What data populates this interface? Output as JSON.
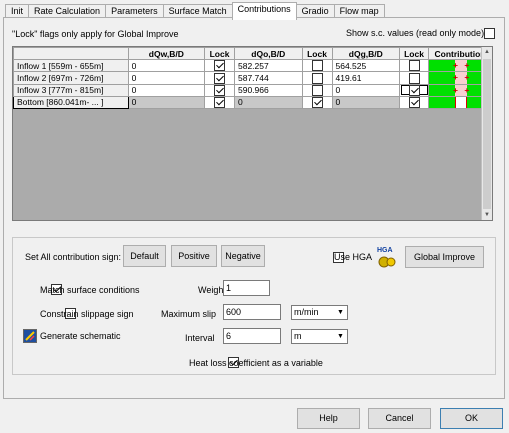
{
  "tabs": [
    "Init",
    "Rate Calculation",
    "Parameters",
    "Surface Match",
    "Contributions",
    "Gradio",
    "Flow map"
  ],
  "active_tab": "Contributions",
  "lock_note": "\"Lock\" flags only apply for Global Improve",
  "show_sc": {
    "label": "Show s.c. values (read only mode)",
    "checked": false
  },
  "grid": {
    "columns": [
      "",
      "dQw,B/D",
      "Lock",
      "dQo,B/D",
      "Lock",
      "dQg,B/D",
      "Lock",
      "Contribution"
    ],
    "rows": [
      {
        "name": "Inflow 1  [559m - 655m]",
        "dqw": "0",
        "lock_w": true,
        "dqo": "582.257",
        "lock_o": false,
        "dqg": "564.525",
        "lock_g": false,
        "contrib": "+ +"
      },
      {
        "name": "Inflow 2  [697m - 726m]",
        "dqw": "0",
        "lock_w": true,
        "dqo": "587.744",
        "lock_o": false,
        "dqg": "419.61",
        "lock_g": false,
        "contrib": "+ +"
      },
      {
        "name": "Inflow 3  [777m - 815m]",
        "dqw": "0",
        "lock_w": true,
        "dqo": "590.966",
        "lock_o": false,
        "dqg": "0",
        "lock_g": true,
        "contrib": "+ +"
      },
      {
        "name": "Bottom   [860.041m- ... ]",
        "dqw": "0",
        "lock_w": true,
        "dqo": "0",
        "lock_o": true,
        "dqg": "0",
        "lock_g": true,
        "contrib": ""
      }
    ]
  },
  "contribution_sign": {
    "label": "Set All contribution sign:",
    "default_label": "Default",
    "positive_label": "Positive",
    "negative_label": "Negative"
  },
  "use_hga": {
    "label": "Use HGA",
    "checked": false,
    "icon_text": "HGA"
  },
  "global_improve_label": "Global Improve",
  "match_surface": {
    "label": "Match surface conditions",
    "checked": true
  },
  "constrain_slippage": {
    "label": "Constrain slippage sign",
    "checked": false
  },
  "generate_schematic_label": "Generate schematic",
  "weight": {
    "label": "Weight",
    "value": "1"
  },
  "max_slip": {
    "label": "Maximum slip",
    "value": "600",
    "unit": "m/min"
  },
  "interval": {
    "label": "Interval",
    "value": "6",
    "unit": "m"
  },
  "heat_loss": {
    "label": "Heat loss coefficient as a variable",
    "checked": true
  },
  "footer": {
    "help_label": "Help",
    "cancel_label": "Cancel",
    "ok_label": "OK"
  },
  "colors": {
    "contribution_green": "#00e000",
    "contribution_red": "#e00000",
    "default_button_border": "#3c7fb1"
  }
}
